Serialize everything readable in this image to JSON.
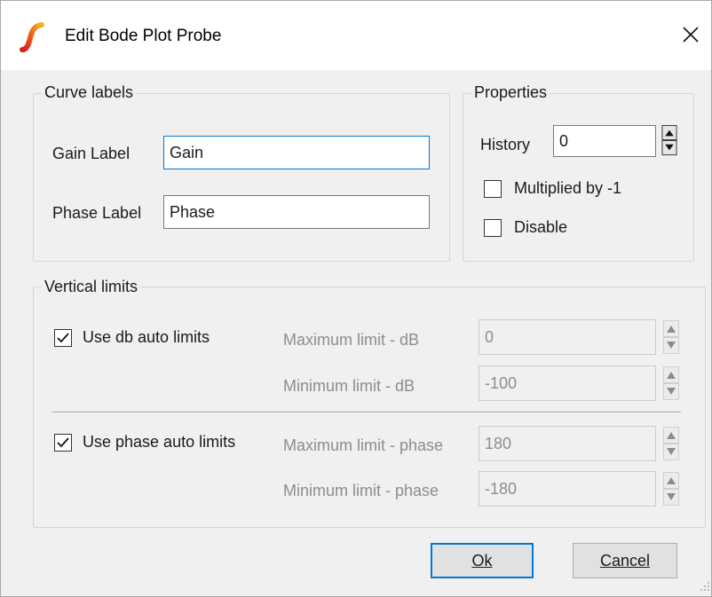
{
  "window": {
    "title": "Edit Bode Plot Probe"
  },
  "curve_labels": {
    "title": "Curve labels",
    "gain_label": "Gain Label",
    "gain_value": "Gain",
    "phase_label": "Phase Label",
    "phase_value": "Phase"
  },
  "properties": {
    "title": "Properties",
    "history_label": "History",
    "history_value": "0",
    "multiplied_label": "Multiplied by -1",
    "multiplied_checked": false,
    "disable_label": "Disable",
    "disable_checked": false
  },
  "vertical_limits": {
    "title": "Vertical limits",
    "db_auto_label": "Use db auto limits",
    "db_auto_checked": true,
    "max_db_label": "Maximum limit - dB",
    "max_db_value": "0",
    "min_db_label": "Minimum limit - dB",
    "min_db_value": "-100",
    "phase_auto_label": "Use phase auto limits",
    "phase_auto_checked": true,
    "max_phase_label": "Maximum limit - phase",
    "max_phase_value": "180",
    "min_phase_label": "Minimum limit - phase",
    "min_phase_value": "-180"
  },
  "buttons": {
    "ok": "Ok",
    "cancel": "Cancel"
  },
  "colors": {
    "focus": "#0078d7",
    "background": "#f0f0f0",
    "icon_red": "#e8401c",
    "icon_orange": "#f5a623"
  }
}
